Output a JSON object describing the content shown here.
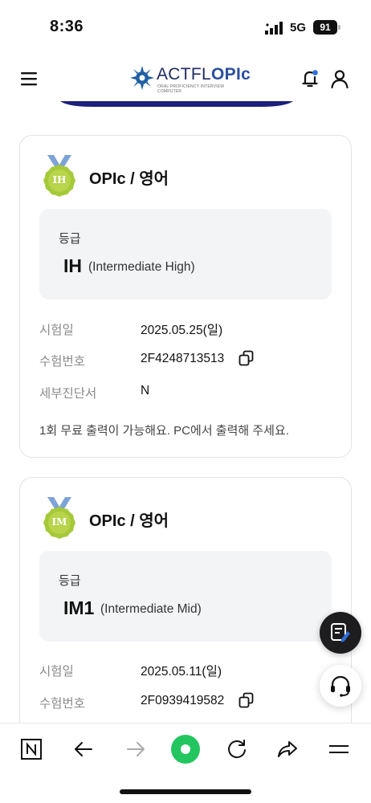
{
  "status_bar": {
    "time": "8:36",
    "network": "5G",
    "battery": "91"
  },
  "header": {
    "logo_text_light": "ACTFL",
    "logo_text_bold": "OPIc",
    "logo_sub_1": "ORAL PROFICIENCY INTERVIEW",
    "logo_sub_2": "COMPUTER"
  },
  "cards": [
    {
      "medal": "IH",
      "title": "OPIc / 영어",
      "grade_label": "등급",
      "grade_code": "IH",
      "grade_desc": "(Intermediate High)",
      "rows": [
        {
          "label": "시험일",
          "value": "2025.05.25(일)"
        },
        {
          "label": "수험번호",
          "value": "2F4248713513"
        },
        {
          "label": "세부진단서",
          "value": "N"
        }
      ],
      "note": "1회 무료 출력이 가능해요. PC에서 출력해 주세요."
    },
    {
      "medal": "IM",
      "title": "OPIc / 영어",
      "grade_label": "등급",
      "grade_code": "IM1",
      "grade_desc": "(Intermediate Mid)",
      "rows": [
        {
          "label": "시험일",
          "value": "2025.05.11(일)"
        },
        {
          "label": "수험번호",
          "value": "2F0939419582"
        }
      ]
    }
  ],
  "colors": {
    "medal": "#a6c93a",
    "ribbon": "#7ea3d6",
    "brand": "#1f2a63",
    "browser_home": "#22c55e"
  },
  "icons": [
    "menu-icon",
    "notification-bell-icon",
    "user-icon",
    "copy-icon",
    "edit-note-icon",
    "headset-icon",
    "naver-n-icon",
    "back-arrow-icon",
    "forward-arrow-icon",
    "home-dot-icon",
    "reload-icon",
    "share-icon",
    "hamburger-icon"
  ]
}
